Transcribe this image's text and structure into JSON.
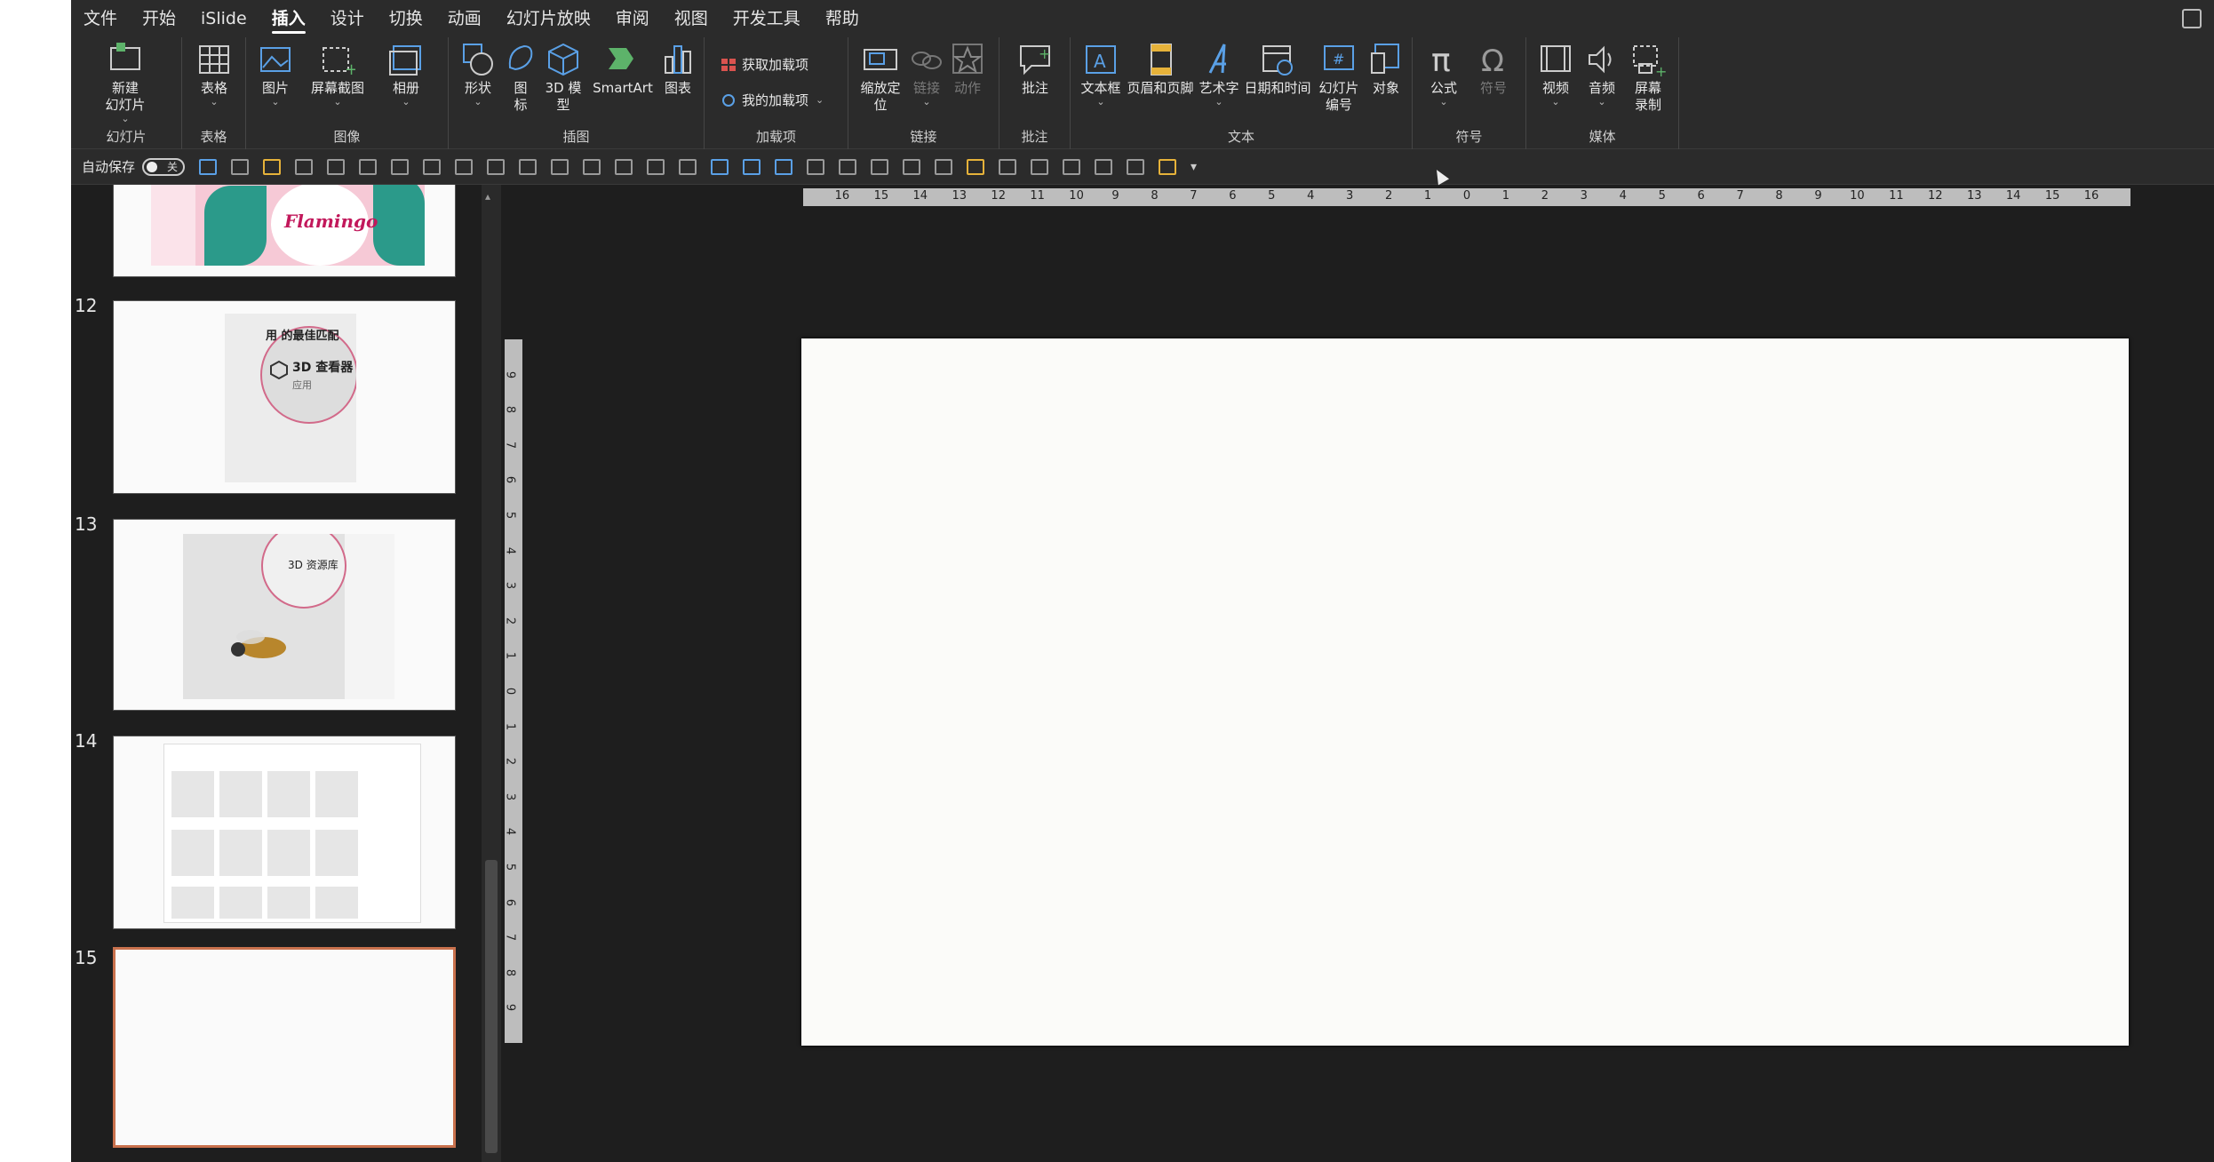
{
  "menu": {
    "tabs": [
      "文件",
      "开始",
      "iSlide",
      "插入",
      "设计",
      "切换",
      "动画",
      "幻灯片放映",
      "审阅",
      "视图",
      "开发工具",
      "帮助"
    ],
    "active": "插入"
  },
  "ribbon": {
    "new_slide": "新建\n幻灯片",
    "table": "表格",
    "picture": "图片",
    "screenshot": "屏幕截图",
    "album": "相册",
    "shapes": "形状",
    "icons": "图\n标",
    "model3d": "3D 模\n型",
    "smartart": "SmartArt",
    "chart": "图表",
    "get_addins": "获取加载项",
    "my_addins": "我的加载项",
    "zoom": "缩放定\n位",
    "link": "链接",
    "action": "动作",
    "comment": "批注",
    "textbox": "文本框",
    "header_footer": "页眉和页脚",
    "wordart": "艺术字",
    "datetime": "日期和时间",
    "slide_number": "幻灯片\n编号",
    "object": "对象",
    "equation": "公式",
    "symbol": "符号",
    "video": "视频",
    "audio": "音频",
    "screen_record": "屏幕\n录制",
    "groups": {
      "slides": "幻灯片",
      "tables": "表格",
      "images": "图像",
      "illustrations": "插图",
      "addins": "加载项",
      "links": "链接",
      "comments": "批注",
      "text": "文本",
      "symbols": "符号",
      "media": "媒体"
    }
  },
  "qat": {
    "autosave_label": "自动保存",
    "autosave_state": "关"
  },
  "thumbnails": {
    "numbers": [
      "12",
      "13",
      "14",
      "15"
    ],
    "slide12_text1": "用 的最佳匹配",
    "slide12_text2": "3D 查看器",
    "slide12_text3": "应用",
    "slide13_text": "3D 资源库",
    "slide11_text": "Flamingo",
    "selected": "15"
  },
  "ruler": {
    "h": [
      "16",
      "15",
      "14",
      "13",
      "12",
      "11",
      "10",
      "9",
      "8",
      "7",
      "6",
      "5",
      "4",
      "3",
      "2",
      "1",
      "0",
      "1",
      "2",
      "3",
      "4",
      "5",
      "6",
      "7",
      "8",
      "9",
      "10",
      "11",
      "12",
      "13",
      "14",
      "15",
      "16"
    ],
    "v": [
      "9",
      "8",
      "7",
      "6",
      "5",
      "4",
      "3",
      "2",
      "1",
      "0",
      "1",
      "2",
      "3",
      "4",
      "5",
      "6",
      "7",
      "8",
      "9"
    ]
  },
  "colors": {
    "background": "#1e1e1e",
    "ribbon": "#2b2b2b",
    "selected_border": "#c9714d",
    "slide": "#fbfbf9"
  }
}
